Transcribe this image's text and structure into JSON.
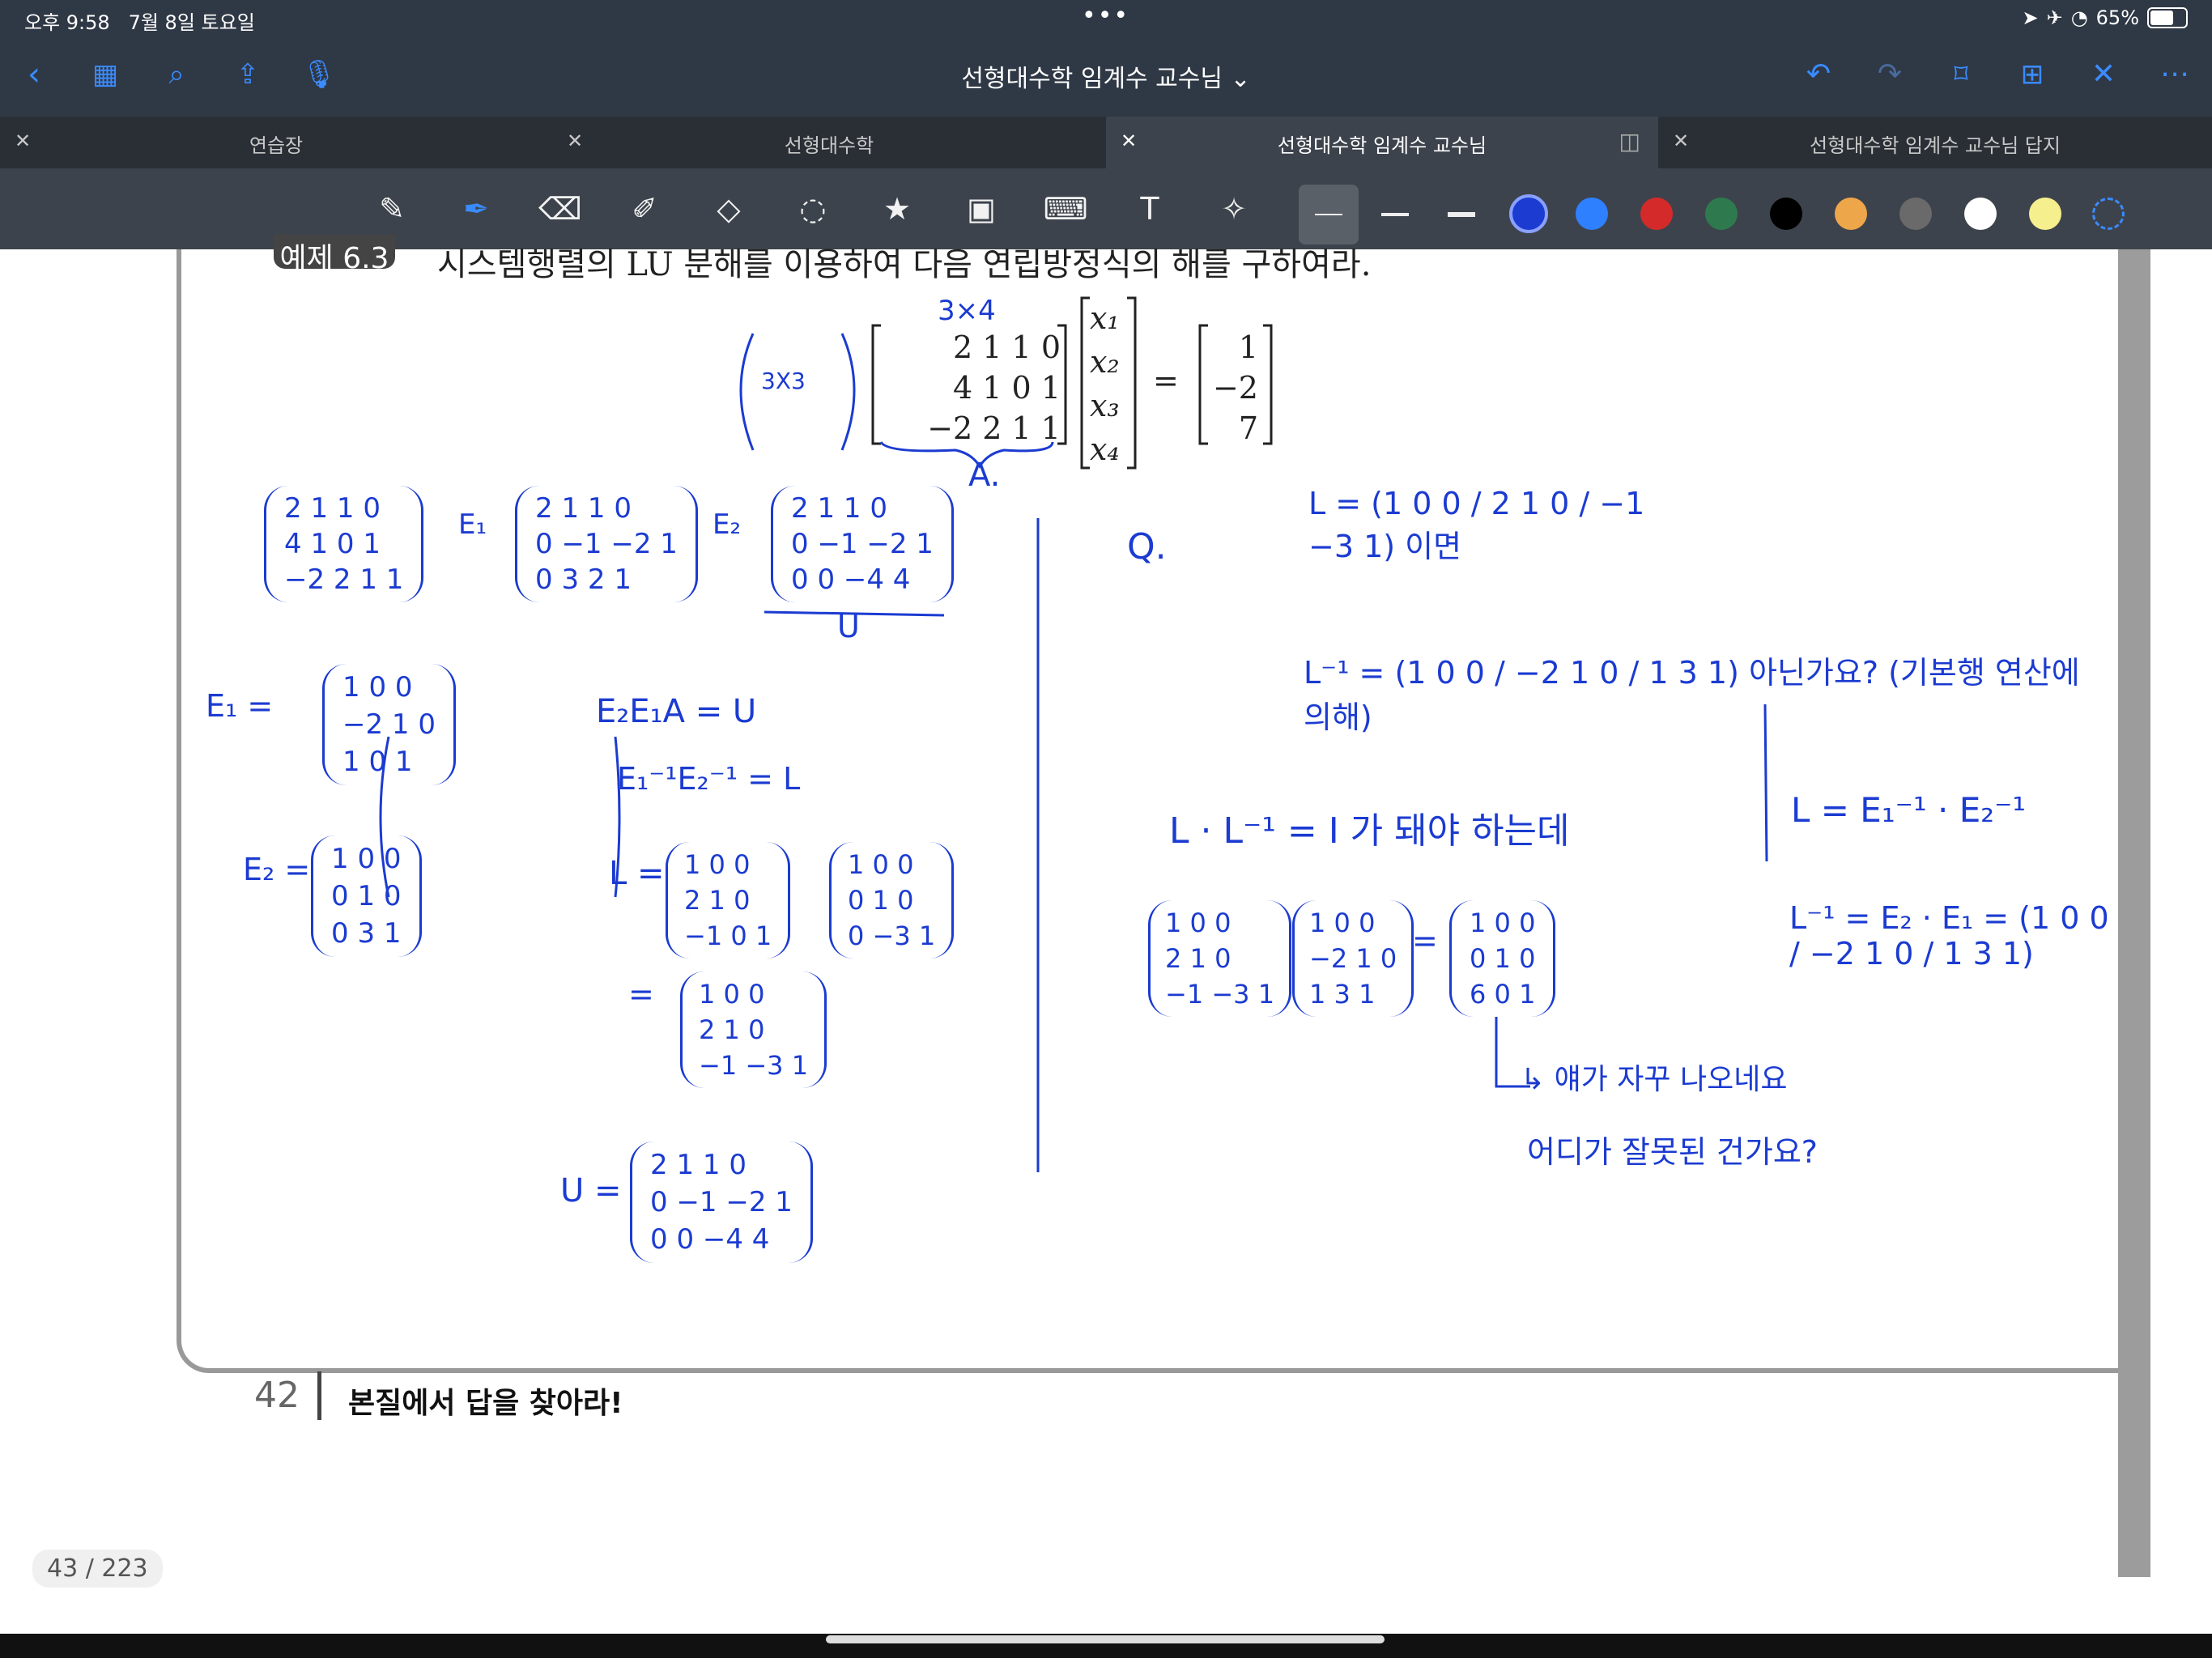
{
  "status_bar": {
    "time": "오후 9:58",
    "date": "7월 8일 토요일",
    "battery": "65%",
    "dots": "•••"
  },
  "toolbar": {
    "title": "선형대수학 임계수 교수님 ⌄"
  },
  "tabs": [
    {
      "label": "연습장"
    },
    {
      "label": "선형대수학"
    },
    {
      "label": "선형대수학 임계수 교수님"
    },
    {
      "label": "선형대수학 임계수 교수님 답지"
    }
  ],
  "colors": {
    "blue": "#1b3bd1",
    "accent": "#3a8bff"
  },
  "page": {
    "badge": "예제 6.3",
    "problem": "시스템행렬의 LU 분해를 이용하여 다음 연립방정식의 해를 구하여라.",
    "matrix_rows": [
      "2 1 1 0",
      "4 1 0 1",
      "−2 2 1 1"
    ],
    "x_vec": [
      "x₁",
      "x₂",
      "x₃",
      "x₄"
    ],
    "b_vec": [
      "1",
      "−2",
      "7"
    ],
    "equals": "=",
    "page_number": "42",
    "footer": "본질에서 답을 찾아라!"
  },
  "pager": {
    "indicator": "43 / 223"
  },
  "handwriting": {
    "note_3x4": "3×4",
    "note_3x3": "3X3",
    "note_A": "A.",
    "q_mark": "Q.",
    "eq1": "L = (1 0 0 / 2 1 0 / −1 −3 1) 이면",
    "eq2": "L⁻¹ = (1 0 0 / −2 1 0 / 1 3 1) 아닌가요? (기본행 연산에 의해)",
    "eq3": "L · L⁻¹ = I 가 돼야 하는데",
    "eq4": "L = E₁⁻¹ · E₂⁻¹",
    "eq5": "L⁻¹ = E₂ · E₁ = (1 0 0 / −2 1 0 / 1 3 1)",
    "note_bottom1": "↳ 얘가 자꾸 나오네요",
    "note_bottom2": "어디가 잘못된 건가요?",
    "label_E1": "E₁ =",
    "label_E2": "E₂ =",
    "label_EEA": "E₂E₁A = U",
    "label_L": "E₁⁻¹E₂⁻¹ = L",
    "label_U": "U =",
    "arrow1": "E₁",
    "arrow2": "E₂",
    "under_U": "U",
    "L_eq": "L =",
    "eq_sign": "="
  }
}
